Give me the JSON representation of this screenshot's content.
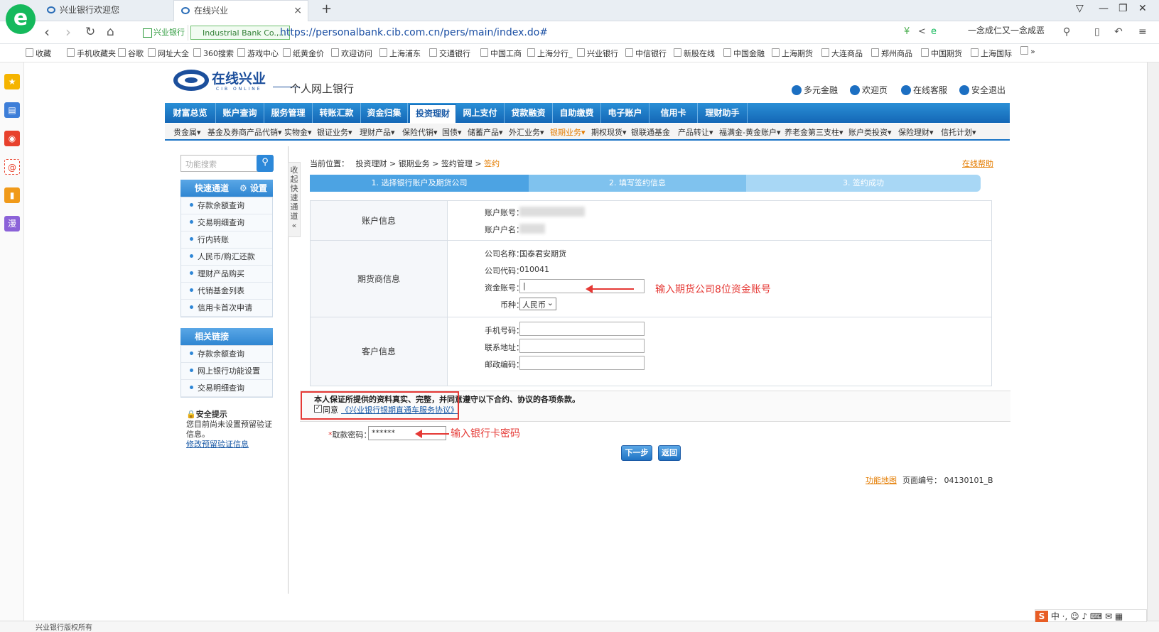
{
  "browser": {
    "tabs": [
      {
        "title": "兴业银行欢迎您"
      },
      {
        "title": "在线兴业",
        "close": "×"
      }
    ],
    "new_tab": "+",
    "logo": "e",
    "site_badge": "兴业银行",
    "cert_badge": "Industrial Bank Co.,...",
    "url": "https://personalbank.cib.com.cn/pers/main/index.do#",
    "hot_search": "一念成仁又一念成恶",
    "bookmarks": [
      "收藏",
      "手机收藏夹",
      "谷歌",
      "网址大全",
      "360搜索",
      "游戏中心",
      "纸黄金价",
      "欢迎访问",
      "上海浦东",
      "交通银行",
      "中国工商",
      "上海分行_",
      "兴业银行",
      "中信银行",
      "新股在线",
      "中国金融",
      "上海期货",
      "大连商品",
      "郑州商品",
      "中国期货",
      "上海国际"
    ],
    "bookmarks_more": "»"
  },
  "header": {
    "logo_text": "在线兴业",
    "logo_sub": "CIB ONLINE",
    "subtitle": "个人网上银行",
    "links": [
      "多元金融",
      "欢迎页",
      "在线客服",
      "安全退出"
    ]
  },
  "mainnav": [
    "财富总览",
    "账户查询",
    "服务管理",
    "转账汇款",
    "资金归集",
    "投资理财",
    "网上支付",
    "贷款融资",
    "自助缴费",
    "电子账户",
    "信用卡",
    "理财助手"
  ],
  "mainnav_active": "投资理财",
  "subnav": [
    "贵金属▾",
    "基金及券商产品代销▾",
    "实物金▾",
    "银证业务▾",
    "理财产品▾",
    "保险代销▾",
    "国债▾",
    "储蓄产品▾",
    "外汇业务▾",
    "银期业务▾",
    "期权现货▾",
    "银联通基金",
    "产品转让▾",
    "福满金-黄金账户▾",
    "养老金第三支柱▾",
    "账户类投资▾",
    "保险理财▾",
    "信托计划▾"
  ],
  "subnav_active": "银期业务▾",
  "sidebar": {
    "search_placeholder": "功能搜索",
    "quick_title": "快速通道",
    "settings": "设置",
    "quick_items": [
      "存款余额查询",
      "交易明细查询",
      "行内转账",
      "人民币/购汇还款",
      "理财产品购买",
      "代销基金列表",
      "信用卡首次申请"
    ],
    "related_title": "相关链接",
    "related_items": [
      "存款余额查询",
      "网上银行功能设置",
      "交易明细查询"
    ],
    "security_title": "安全提示",
    "security_text": "您目前尚未设置预留验证信息。",
    "security_link": "修改预留验证信息",
    "collapse_label": "收起快速通道"
  },
  "breadcrumb": {
    "prefix": "当前位置：",
    "items": [
      "投资理财",
      "银期业务",
      "签约管理"
    ],
    "current": "签约",
    "help": "在线帮助"
  },
  "steps": [
    "1. 选择银行账户及期货公司",
    "2. 填写签约信息",
    "3. 签约成功"
  ],
  "form": {
    "account_section": "账户信息",
    "account_no_label": "账户账号：",
    "account_name_label": "账户户名：",
    "futures_section": "期货商信息",
    "company_name_label": "公司名称：",
    "company_name": "国泰君安期货",
    "company_code_label": "公司代码：",
    "company_code": "010041",
    "fund_account_label": "资金账号：",
    "fund_account_value": "|",
    "currency_label": "币种：",
    "currency_value": "人民币",
    "customer_section": "客户信息",
    "phone_label": "手机号码：",
    "address_label": "联系地址：",
    "zip_label": "邮政编码："
  },
  "annotations": {
    "fund_account_hint": "输入期货公司8位资金账号",
    "password_hint": "输入银行卡密码"
  },
  "agreement": {
    "statement": "本人保证所提供的资料真实、完整，并同意遵守以下合约、协议的各项条款。",
    "check_mark": "✓",
    "agree_label": "同意",
    "link": "《兴业银行银期直通车服务协议》"
  },
  "password": {
    "label": "取款密码：",
    "required": "*",
    "value": "******"
  },
  "buttons": {
    "next": "下一步",
    "back": "返回"
  },
  "footer": {
    "func_nav": "功能地图",
    "page_no_label": "页面编号：",
    "page_no": "04130101_B"
  },
  "statusbar": {
    "left": "兴业银行版权所有",
    "ime_logo": "S",
    "ime_mode": "中"
  },
  "colors": {
    "brand_blue": "#1c4f9c",
    "nav_blue": "#1a74c6",
    "highlight": "#e47c00",
    "annotation": "#e53935"
  }
}
